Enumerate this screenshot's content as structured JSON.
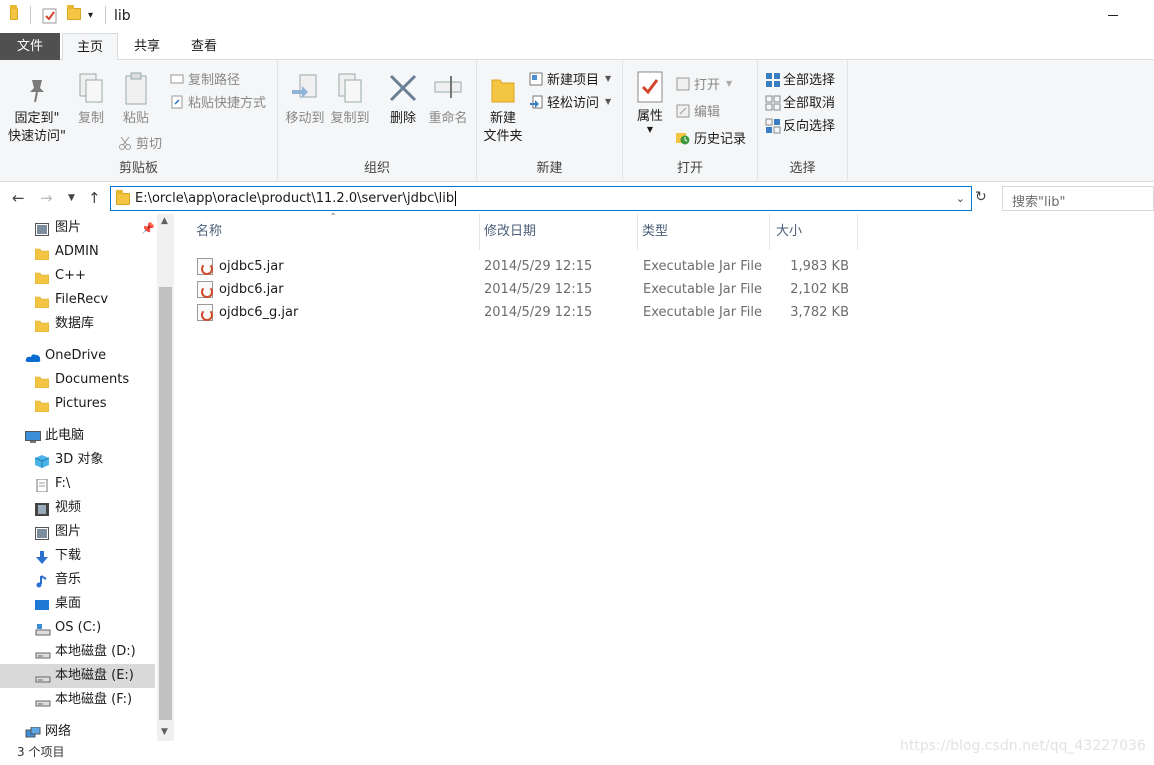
{
  "window": {
    "title": "lib"
  },
  "ribbon_tabs": {
    "file": "文件",
    "home": "主页",
    "share": "共享",
    "view": "查看"
  },
  "clipboard": {
    "pin_line1": "固定到\"",
    "pin_line2": "快速访问\"",
    "copy": "复制",
    "paste": "粘贴",
    "copy_path": "复制路径",
    "paste_shortcut": "粘贴快捷方式",
    "cut": "剪切",
    "label": "剪贴板"
  },
  "organize": {
    "move_to": "移动到",
    "copy_to": "复制到",
    "delete": "删除",
    "rename": "重命名",
    "label": "组织"
  },
  "new": {
    "new_item": "新建项目",
    "easy_access": "轻松访问",
    "new_folder_line1": "新建",
    "new_folder_line2": "文件夹",
    "label": "新建"
  },
  "open": {
    "properties": "属性",
    "open": "打开",
    "edit": "编辑",
    "history": "历史记录",
    "label": "打开"
  },
  "select": {
    "select_all": "全部选择",
    "select_none": "全部取消",
    "invert": "反向选择",
    "label": "选择"
  },
  "address": {
    "path": "E:\\orcle\\app\\oracle\\product\\11.2.0\\server\\jdbc\\lib",
    "search_placeholder": "搜索\"lib\""
  },
  "nav": {
    "items": [
      {
        "label": "图片",
        "icon": "pictures-icon"
      },
      {
        "label": "ADMIN",
        "icon": "folder-icon"
      },
      {
        "label": "C++",
        "icon": "folder-icon"
      },
      {
        "label": "FileRecv",
        "icon": "folder-icon"
      },
      {
        "label": "数据库",
        "icon": "folder-icon"
      },
      {
        "label": "OneDrive",
        "icon": "onedrive-icon"
      },
      {
        "label": "Documents",
        "icon": "folder-icon"
      },
      {
        "label": "Pictures",
        "icon": "folder-icon"
      },
      {
        "label": "此电脑",
        "icon": "computer-icon"
      },
      {
        "label": "3D 对象",
        "icon": "3d-objects-icon"
      },
      {
        "label": "F:\\",
        "icon": "document-icon"
      },
      {
        "label": "视频",
        "icon": "video-icon"
      },
      {
        "label": "图片",
        "icon": "pictures-icon"
      },
      {
        "label": "下载",
        "icon": "download-icon"
      },
      {
        "label": "音乐",
        "icon": "music-icon"
      },
      {
        "label": "桌面",
        "icon": "desktop-icon"
      },
      {
        "label": "OS (C:)",
        "icon": "os-drive-icon"
      },
      {
        "label": "本地磁盘 (D:)",
        "icon": "drive-icon"
      },
      {
        "label": "本地磁盘 (E:)",
        "icon": "drive-icon",
        "selected": true
      },
      {
        "label": "本地磁盘 (F:)",
        "icon": "drive-icon"
      },
      {
        "label": "网络",
        "icon": "network-icon"
      }
    ]
  },
  "columns": {
    "name": "名称",
    "date": "修改日期",
    "type": "类型",
    "size": "大小"
  },
  "files": [
    {
      "name": "ojdbc5.jar",
      "date": "2014/5/29 12:15",
      "type": "Executable Jar File",
      "size": "1,983 KB"
    },
    {
      "name": "ojdbc6.jar",
      "date": "2014/5/29 12:15",
      "type": "Executable Jar File",
      "size": "2,102 KB"
    },
    {
      "name": "ojdbc6_g.jar",
      "date": "2014/5/29 12:15",
      "type": "Executable Jar File",
      "size": "3,782 KB"
    }
  ],
  "status": {
    "count": "3 个项目"
  },
  "watermark": "https://blog.csdn.net/qq_43227036",
  "colors": {
    "accent": "#0078d7",
    "file_tab": "#505050",
    "folder": "#f3c542",
    "selected_nav": "#d9d9d9"
  }
}
